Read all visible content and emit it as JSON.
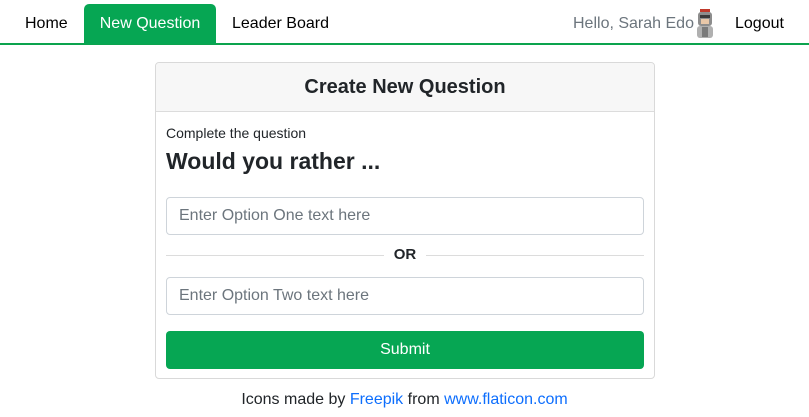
{
  "nav": {
    "home_label": "Home",
    "new_question_label": "New Question",
    "leaderboard_label": "Leader Board",
    "greeting": "Hello, Sarah Edo",
    "logout_label": "Logout",
    "active_tab": "New Question",
    "accent_color": "#06a653",
    "avatar_icon": "knight-avatar-icon"
  },
  "card": {
    "title": "Create New Question",
    "hint": "Complete the question",
    "question_prefix": "Would you rather ...",
    "option_one_placeholder": "Enter Option One text here",
    "option_one_value": "",
    "divider_text": "OR",
    "option_two_placeholder": "Enter Option Two text here",
    "option_two_value": "",
    "submit_label": "Submit"
  },
  "footer": {
    "prefix": "Icons made by",
    "author_link": "Freepik",
    "middle": "from",
    "site_link": "www.flaticon.com"
  }
}
